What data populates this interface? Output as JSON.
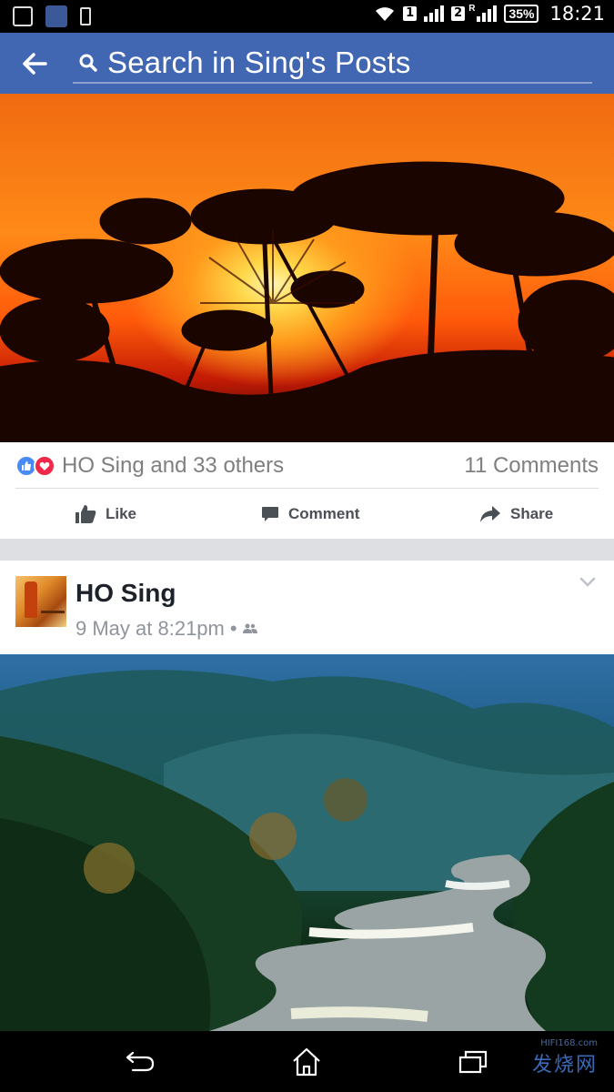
{
  "status_bar": {
    "sim1": "1",
    "sim2": "2",
    "roaming": "R",
    "battery": "35%",
    "time": "18:21"
  },
  "header": {
    "search_placeholder": "Search in Sing's Posts"
  },
  "post1": {
    "reactors": "HO Sing and 33 others",
    "comments": "11 Comments",
    "actions": {
      "like": "Like",
      "comment": "Comment",
      "share": "Share"
    }
  },
  "post2": {
    "author": "HO Sing",
    "timestamp": "9 May at 8:21pm",
    "separator": "•"
  },
  "watermark": {
    "url": "HIFI168.com",
    "text": "发烧网"
  },
  "colors": {
    "brand": "#4267b2",
    "like_blue": "#4a8af4",
    "love_red": "#f0284a",
    "meta_gray": "#90949c"
  }
}
